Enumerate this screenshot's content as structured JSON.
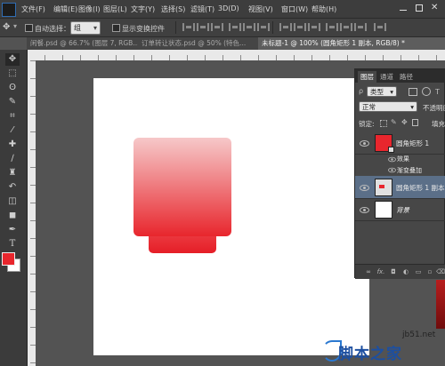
{
  "menu": {
    "items": [
      "文件(F)",
      "编辑(E)",
      "图像(I)",
      "图层(L)",
      "文字(Y)",
      "选择(S)",
      "滤镜(T)",
      "3D(D)",
      "视图(V)",
      "窗口(W)",
      "帮助(H)"
    ],
    "window_controls": [
      "minimize",
      "maximize",
      "close"
    ]
  },
  "options": {
    "auto_select_label": "自动选择：",
    "auto_select_value": "组",
    "show_transform_label": "显示变换控件"
  },
  "tabs": [
    "闲餐.psd @ 66.7% (图层 7, RGB...",
    "订单转让状态.psd @ 50% (特色...",
    "未标题-1 @ 100% (圆角矩形 1 副本, RGB/8) *"
  ],
  "layers_panel": {
    "tabs": [
      "图层",
      "通道",
      "路径"
    ],
    "filter_kind": "类型",
    "blend_mode": "正常",
    "opacity_label": "不透明度",
    "lock_label": "锁定:",
    "fill_label": "填充",
    "layers": [
      {
        "name": "圆角矩形 1",
        "thumb_color": "#e8262d",
        "selected": false
      },
      {
        "name": "效果",
        "type": "effects-group"
      },
      {
        "name": "渐变叠加",
        "type": "effect"
      },
      {
        "name": "圆角矩形 1 副本",
        "thumb_color": "#e8262d",
        "selected": true
      },
      {
        "name": "背景",
        "thumb_color": "#ffffff",
        "selected": false
      }
    ],
    "footer_icons": [
      "link-icon",
      "fx-icon",
      "mask-icon",
      "adjustment-icon",
      "group-icon",
      "new-layer-icon",
      "trash-icon"
    ],
    "fx_label": "fx."
  },
  "tools": [
    "move",
    "marquee",
    "lasso",
    "quick-select",
    "crop",
    "eyedropper",
    "healing",
    "brush",
    "stamp",
    "history-brush",
    "eraser",
    "gradient",
    "blur",
    "dodge",
    "pen",
    "type",
    "path-select",
    "shape",
    "hand",
    "zoom"
  ],
  "colors": {
    "foreground": "#e8262d",
    "background": "#ffffff",
    "accent": "#e8262d"
  },
  "watermark": {
    "url": "jb51.net",
    "logo_text": "脚本之家"
  }
}
